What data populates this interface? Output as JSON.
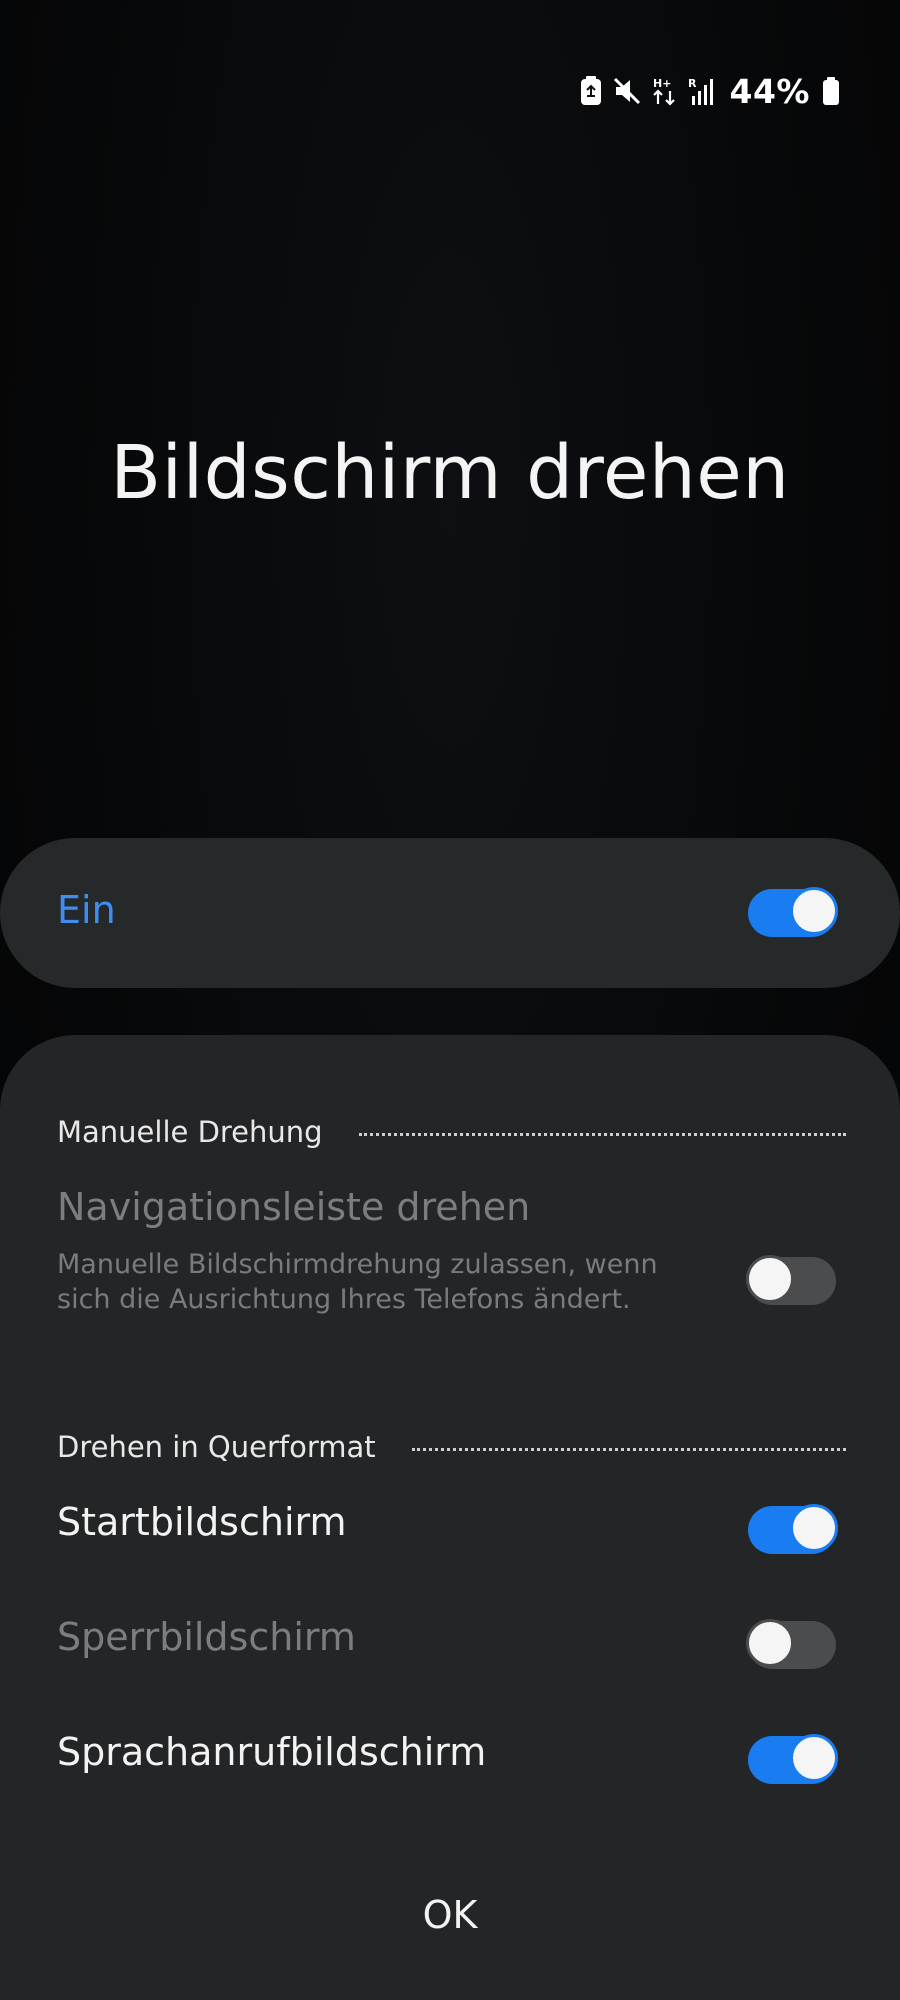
{
  "status_bar": {
    "battery_percent": "44%",
    "icons": [
      "battery-saver-icon",
      "mute-icon",
      "network-hplus-icon",
      "signal-roaming-icon",
      "battery-icon"
    ]
  },
  "page": {
    "title": "Bildschirm drehen"
  },
  "main_toggle": {
    "label": "Ein",
    "state": true
  },
  "sections": {
    "manual": {
      "header": "Manuelle Drehung",
      "item": {
        "title": "Navigationsleiste drehen",
        "description": "Manuelle Bildschirmdrehung zulassen, wenn sich die Ausrichtung Ihres Telefons ändert.",
        "state": false
      }
    },
    "landscape": {
      "header": "Drehen in Querformat",
      "items": [
        {
          "title": "Startbildschirm",
          "state": true
        },
        {
          "title": "Sperrbildschirm",
          "state": false
        },
        {
          "title": "Sprachanrufbildschirm",
          "state": true
        }
      ]
    }
  },
  "actions": {
    "ok_label": "OK"
  },
  "colors": {
    "accent": "#1a7cf1",
    "accent_text": "#3d8ef0",
    "card": "#232526"
  }
}
